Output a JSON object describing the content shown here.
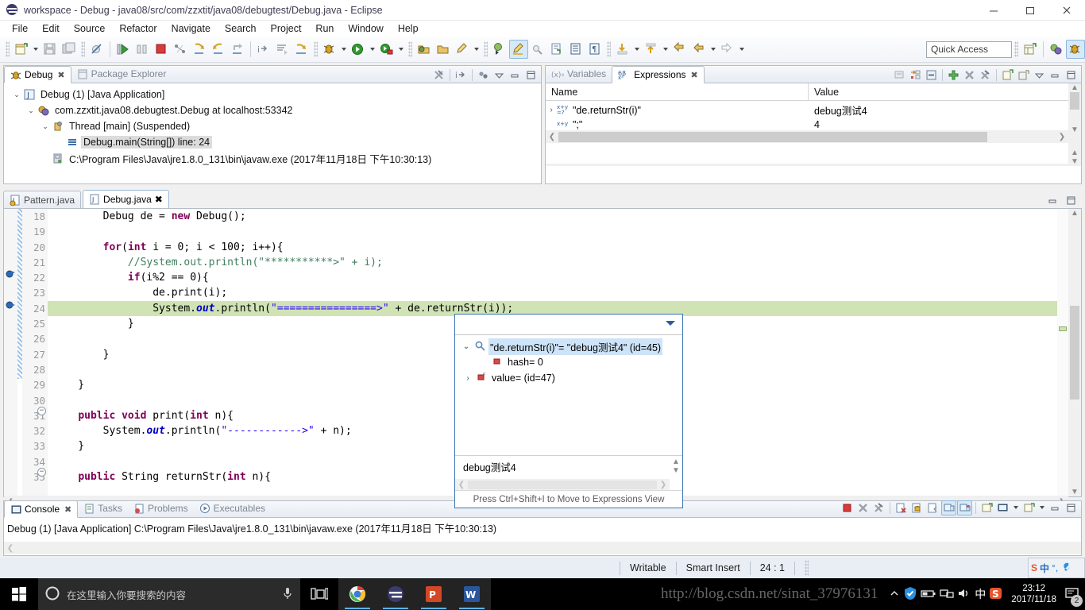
{
  "window": {
    "title": "workspace - Debug - java08/src/com/zzxtit/java08/debugtest/Debug.java - Eclipse",
    "icon": "eclipse-icon",
    "minimize_label": "–",
    "maximize_label": "❐",
    "close_label": "✕"
  },
  "menu": {
    "items": [
      "File",
      "Edit",
      "Source",
      "Refactor",
      "Navigate",
      "Search",
      "Project",
      "Run",
      "Window",
      "Help"
    ]
  },
  "toolbar": {
    "quick_access_placeholder": "Quick Access",
    "quick_access_value": "",
    "groups": [
      {
        "buttons": [
          {
            "name": "new-wizard-icon",
            "label": "New"
          },
          {
            "name": "dropdown-arrow-icon",
            "label": "",
            "arrow": true
          },
          {
            "name": "save-icon",
            "label": "Save"
          },
          {
            "name": "save-all-icon",
            "label": "Save All"
          }
        ]
      },
      {
        "buttons": [
          {
            "name": "skip-breakpoints-icon",
            "label": "Skip All Breakpoints"
          }
        ]
      },
      {
        "buttons": [
          {
            "name": "resume-icon",
            "label": "Resume"
          },
          {
            "name": "suspend-icon",
            "label": "Suspend"
          },
          {
            "name": "terminate-icon",
            "label": "Terminate"
          },
          {
            "name": "disconnect-icon",
            "label": "Disconnect"
          },
          {
            "name": "step-into-icon",
            "label": "Step Into"
          },
          {
            "name": "step-over-icon",
            "label": "Step Over"
          },
          {
            "name": "step-return-icon",
            "label": "Step Return"
          }
        ]
      },
      {
        "buttons": [
          {
            "name": "step-into-selection-icon",
            "label": "Step Into Selection"
          },
          {
            "name": "drop-to-frame-icon",
            "label": "Drop to Frame"
          },
          {
            "name": "use-step-filters-icon",
            "label": "Use Step Filters"
          }
        ]
      },
      {
        "buttons": [
          {
            "name": "debug-icon",
            "label": "Debug"
          },
          {
            "name": "dropdown-arrow-icon",
            "label": "",
            "arrow": true
          },
          {
            "name": "run-icon",
            "label": "Run"
          },
          {
            "name": "dropdown-arrow-icon",
            "label": "",
            "arrow": true
          },
          {
            "name": "external-tools-icon",
            "label": "External Tools"
          },
          {
            "name": "dropdown-arrow-icon",
            "label": "",
            "arrow": true
          }
        ]
      },
      {
        "buttons": [
          {
            "name": "new-java-package-icon",
            "label": "New Java Package"
          },
          {
            "name": "new-java-class-icon",
            "label": "New Java Class"
          },
          {
            "name": "new-annotation-icon",
            "label": "New Annotation"
          },
          {
            "name": "dropdown-arrow-icon",
            "label": "",
            "arrow": true
          }
        ]
      },
      {
        "buttons": [
          {
            "name": "open-type-icon",
            "label": "Open Type"
          },
          {
            "name": "toggle-mark-occurrences-icon",
            "label": "Toggle Mark Occurrences",
            "active": true
          },
          {
            "name": "search-icon",
            "label": "Search"
          },
          {
            "name": "open-task-icon",
            "label": "Open Task"
          },
          {
            "name": "toggle-block-selection-icon",
            "label": "Toggle Block Selection"
          },
          {
            "name": "show-whitespace-icon",
            "label": "Show Whitespace Characters"
          }
        ]
      },
      {
        "buttons": [
          {
            "name": "next-annotation-icon",
            "label": "Next Annotation"
          },
          {
            "name": "dropdown-arrow-icon",
            "label": "",
            "arrow": true
          },
          {
            "name": "previous-annotation-icon",
            "label": "Previous Annotation"
          },
          {
            "name": "dropdown-arrow-icon",
            "label": "",
            "arrow": true
          },
          {
            "name": "last-edit-location-icon",
            "label": "Last Edit Location"
          },
          {
            "name": "back-icon",
            "label": "Back"
          },
          {
            "name": "dropdown-arrow-icon",
            "label": "",
            "arrow": true
          },
          {
            "name": "forward-icon",
            "label": "Forward"
          },
          {
            "name": "dropdown-arrow-icon",
            "label": "",
            "arrow": true
          }
        ]
      }
    ],
    "perspective_buttons": [
      {
        "name": "open-perspective-icon",
        "label": "Open Perspective"
      },
      {
        "name": "java-perspective-icon",
        "label": "Java"
      },
      {
        "name": "debug-perspective-icon",
        "label": "Debug",
        "active": true
      }
    ]
  },
  "debug_view": {
    "tabs": [
      {
        "label": "Debug",
        "icon": "debug-icon",
        "selected": true,
        "closeable": true
      },
      {
        "label": "Package Explorer",
        "icon": "package-explorer-icon",
        "selected": false,
        "closeable": false
      }
    ],
    "toolbar": [
      {
        "name": "remove-all-terminated-icon",
        "label": "Remove All Terminated"
      },
      {
        "name": "connect-icon",
        "label": "Connect"
      },
      {
        "name": "view-menu-icon",
        "label": "View Menu"
      }
    ],
    "tree": [
      {
        "indent": 0,
        "twist": "⌄",
        "icon": "launch-icon",
        "label": "Debug (1) [Java Application]",
        "selected": false
      },
      {
        "indent": 1,
        "twist": "⌄",
        "icon": "java-process-icon",
        "label": "com.zzxtit.java08.debugtest.Debug at localhost:53342",
        "selected": false
      },
      {
        "indent": 2,
        "twist": "⌄",
        "icon": "thread-icon",
        "label": "Thread [main] (Suspended)",
        "selected": false
      },
      {
        "indent": 3,
        "twist": "",
        "icon": "stackframe-icon",
        "label": "Debug.main(String[]) line: 24",
        "selected": true
      },
      {
        "indent": 2,
        "twist": "",
        "icon": "jre-icon",
        "label": "C:\\Program Files\\Java\\jre1.8.0_131\\bin\\javaw.exe (2017年11月18日 下午10:30:13)",
        "selected": false
      }
    ]
  },
  "expressions_view": {
    "tabs": [
      {
        "label": "Variables",
        "icon": "variables-icon",
        "selected": false,
        "closeable": false
      },
      {
        "label": "Expressions",
        "icon": "expressions-icon",
        "selected": true,
        "closeable": true
      }
    ],
    "toolbar": [
      {
        "name": "show-logical-structure-icon",
        "label": "Show Logical Structure"
      },
      {
        "name": "collapse-all-icon",
        "label": "Collapse All"
      },
      {
        "name": "collapse-icon",
        "label": "Collapse"
      },
      {
        "name": "add-watch-expression-icon",
        "label": "Add New Expression"
      },
      {
        "name": "remove-expression-icon",
        "label": "Remove Selected Expressions"
      },
      {
        "name": "remove-all-expressions-icon",
        "label": "Remove All Expressions"
      },
      {
        "name": "new-detail-pane-icon",
        "label": "New Detail Pane"
      },
      {
        "name": "detail-pane-layout-icon",
        "label": "Layout"
      },
      {
        "name": "view-menu-icon",
        "label": "View Menu"
      },
      {
        "name": "minimize-icon",
        "label": "Minimize"
      },
      {
        "name": "maximize-icon",
        "label": "Maximize"
      }
    ],
    "columns": [
      "Name",
      "Value"
    ],
    "rows": [
      {
        "twist": "›",
        "icon": "watch-expression-icon",
        "name": "\"de.returnStr(i)\"",
        "value": "debug测试4"
      },
      {
        "twist": "",
        "icon": "watch-expression-icon",
        "name": "\";\"",
        "value": "4"
      }
    ]
  },
  "editor": {
    "tabs": [
      {
        "label": "Pattern.java",
        "icon": "java-file-warning-icon",
        "selected": false,
        "closeable": false
      },
      {
        "label": "Debug.java",
        "icon": "java-file-icon",
        "selected": true,
        "closeable": true
      }
    ],
    "minimize_label": "Minimize",
    "maximize_label": "Maximize",
    "lines": [
      {
        "no": "18",
        "fold": false,
        "breakpoint": false,
        "highlight": false,
        "html": "        Debug de = <span class=\"kw\">new</span> Debug();"
      },
      {
        "no": "19",
        "fold": false,
        "breakpoint": false,
        "highlight": false,
        "html": ""
      },
      {
        "no": "20",
        "fold": false,
        "breakpoint": false,
        "highlight": false,
        "html": "        <span class=\"kw\">for</span>(<span class=\"kw\">int</span> i = 0; i &lt; 100; i++){"
      },
      {
        "no": "21",
        "fold": false,
        "breakpoint": false,
        "highlight": false,
        "html": "            <span class=\"cmt\">//System.out.println(\"***********&gt;\" + i);</span>"
      },
      {
        "no": "22",
        "fold": false,
        "breakpoint": true,
        "highlight": false,
        "html": "            <span class=\"kw\">if</span>(i%2 == 0){"
      },
      {
        "no": "23",
        "fold": false,
        "breakpoint": false,
        "highlight": false,
        "html": "                de.print(i);"
      },
      {
        "no": "24",
        "fold": false,
        "breakpoint": true,
        "highlight": true,
        "html": "                System.<span class=\"fld\">out</span>.println(<span class=\"str\">\"================&gt;\"</span> + de.returnStr(i));"
      },
      {
        "no": "25",
        "fold": false,
        "breakpoint": false,
        "highlight": false,
        "html": "            }"
      },
      {
        "no": "26",
        "fold": false,
        "breakpoint": false,
        "highlight": false,
        "html": ""
      },
      {
        "no": "27",
        "fold": false,
        "breakpoint": false,
        "highlight": false,
        "html": "        }"
      },
      {
        "no": "28",
        "fold": false,
        "breakpoint": false,
        "highlight": false,
        "html": ""
      },
      {
        "no": "29",
        "fold": false,
        "breakpoint": false,
        "highlight": false,
        "html": "    }"
      },
      {
        "no": "30",
        "fold": false,
        "breakpoint": false,
        "highlight": false,
        "html": ""
      },
      {
        "no": "31",
        "fold": true,
        "breakpoint": false,
        "highlight": false,
        "html": "    <span class=\"kw\">public</span> <span class=\"kw\">void</span> print(<span class=\"kw\">int</span> n){"
      },
      {
        "no": "32",
        "fold": false,
        "breakpoint": false,
        "highlight": false,
        "html": "        System.<span class=\"fld\">out</span>.println(<span class=\"str\">\"------------&gt;\"</span> + n);"
      },
      {
        "no": "33",
        "fold": false,
        "breakpoint": false,
        "highlight": false,
        "html": "    }"
      },
      {
        "no": "34",
        "fold": false,
        "breakpoint": false,
        "highlight": false,
        "html": ""
      },
      {
        "no": "35",
        "fold": true,
        "breakpoint": false,
        "highlight": false,
        "html": "    <span class=\"kw\">public</span> String returnStr(<span class=\"kw\">int</span> n){"
      }
    ]
  },
  "inspect_popup": {
    "tree": [
      {
        "twist": "⌄",
        "icon": "inspect-icon",
        "label": "\"de.returnStr(i)\"= \"debug测试4\" (id=45)",
        "selected": true,
        "indent": 0
      },
      {
        "twist": "",
        "icon": "field-icon",
        "label": "hash= 0",
        "selected": false,
        "indent": 1
      },
      {
        "twist": "›",
        "icon": "final-field-icon",
        "label": "value= (id=47)",
        "selected": false,
        "indent": 1
      }
    ],
    "detail_value": "debug测试4",
    "footer": "Press Ctrl+Shift+I to Move to Expressions View",
    "menu_icon": "view-menu-icon"
  },
  "console_view": {
    "tabs": [
      {
        "label": "Console",
        "icon": "console-icon",
        "selected": true,
        "closeable": true
      },
      {
        "label": "Tasks",
        "icon": "tasks-icon",
        "selected": false,
        "closeable": false
      },
      {
        "label": "Problems",
        "icon": "problems-icon",
        "selected": false,
        "closeable": false
      },
      {
        "label": "Executables",
        "icon": "executables-icon",
        "selected": false,
        "closeable": false
      }
    ],
    "toolbar": [
      {
        "name": "terminate-icon",
        "label": "Terminate"
      },
      {
        "name": "remove-launch-icon",
        "label": "Remove Launch"
      },
      {
        "name": "remove-all-terminated-icon",
        "label": "Remove All Terminated Launches"
      },
      {
        "name": "clear-console-icon",
        "label": "Clear Console"
      },
      {
        "name": "scroll-lock-icon",
        "label": "Scroll Lock"
      },
      {
        "name": "word-wrap-icon",
        "label": "Word Wrap"
      },
      {
        "name": "pin-console-icon",
        "label": "Pin Console",
        "active": true
      },
      {
        "name": "show-console-on-output-icon",
        "label": "Show Console When Output Changes",
        "active": true
      },
      {
        "name": "display-selected-console-icon",
        "label": "Display Selected Console"
      },
      {
        "name": "open-console-icon",
        "label": "Open Console"
      },
      {
        "name": "dropdown-arrow-icon",
        "label": ""
      },
      {
        "name": "new-console-view-icon",
        "label": "New Console View"
      },
      {
        "name": "dropdown-arrow-icon",
        "label": ""
      },
      {
        "name": "minimize-icon",
        "label": "Minimize"
      },
      {
        "name": "maximize-icon",
        "label": "Maximize"
      }
    ],
    "process_line": "Debug (1) [Java Application] C:\\Program Files\\Java\\jre1.8.0_131\\bin\\javaw.exe (2017年11月18日 下午10:30:13)"
  },
  "statusbar": {
    "writable": "Writable",
    "insert_mode": "Smart Insert",
    "position": "24 : 1"
  },
  "taskbar": {
    "start_icon": "windows-start-icon",
    "search_placeholder": "在这里输入你要搜索的内容",
    "cortana_icon": "cortana-icon",
    "microphone_icon": "microphone-icon",
    "taskview_icon": "task-view-icon",
    "apps": [
      {
        "name": "chrome-icon",
        "label": "Google Chrome",
        "running": true
      },
      {
        "name": "eclipse-icon",
        "label": "Eclipse",
        "running": true
      },
      {
        "name": "powerpoint-icon",
        "label": "PowerPoint",
        "running": true
      },
      {
        "name": "word-icon",
        "label": "Word",
        "running": true
      }
    ],
    "tray": [
      {
        "name": "tencent-shield-icon",
        "label": "Security"
      },
      {
        "name": "battery-icon",
        "label": "Battery"
      },
      {
        "name": "network-icon",
        "label": "Network"
      },
      {
        "name": "volume-icon",
        "label": "Volume"
      },
      {
        "name": "ime-chinese-icon",
        "label": "中"
      },
      {
        "name": "sogou-icon",
        "label": "Sogou Input"
      }
    ],
    "clock_time": "23:12",
    "clock_date": "2017/11/18",
    "notification_count": "2"
  },
  "ime_bar": {
    "language": "中",
    "punctuation": "°,",
    "tools_icon": "wrench-icon"
  },
  "watermark": "http://blog.csdn.net/sinat_37976131",
  "colors": {
    "highlight_line": "#cfe3b4",
    "selection": "#cde3f7",
    "accent": "#3b74b5",
    "keyword": "#7f0055",
    "string": "#2a00ff",
    "comment": "#3f7f5f"
  }
}
